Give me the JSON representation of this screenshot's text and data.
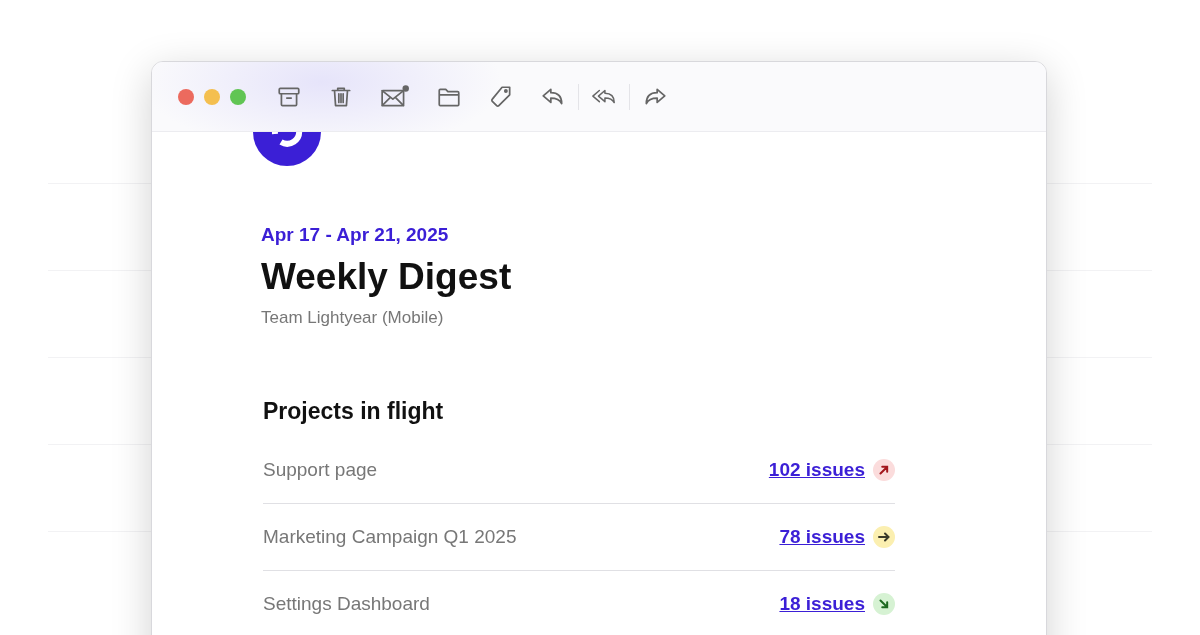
{
  "email": {
    "date_range": "Apr 17 - Apr 21, 2025",
    "title": "Weekly Digest",
    "team": "Team Lightyear (Mobile)",
    "section_title": "Projects in flight",
    "projects": [
      {
        "name": "Support page",
        "issues": "102 issues",
        "kind": "up"
      },
      {
        "name": "Marketing Campaign Q1 2025",
        "issues": "78 issues",
        "kind": "flat"
      },
      {
        "name": "Settings Dashboard",
        "issues": "18 issues",
        "kind": "down"
      }
    ]
  }
}
